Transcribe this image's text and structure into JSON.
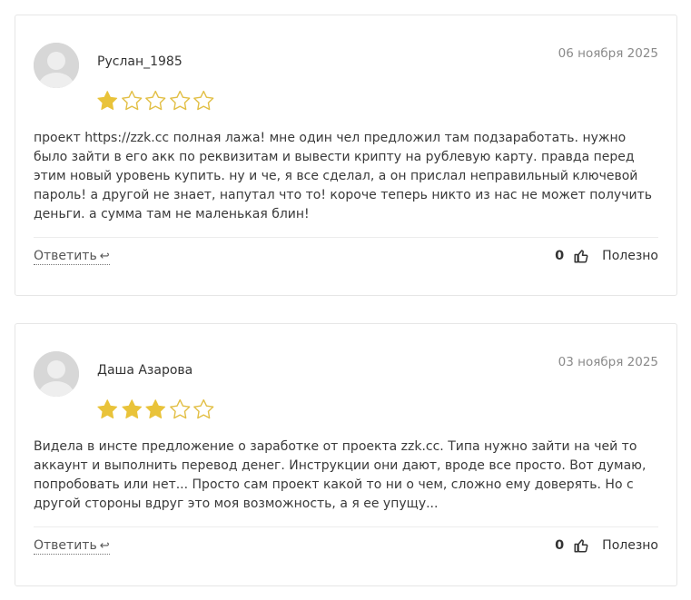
{
  "theme": {
    "star_filled": "#e9c33a",
    "star_empty_stroke": "#e2bf45",
    "avatar_bg": "#d7d7d7",
    "border": "#e6e6e6"
  },
  "reviews": [
    {
      "author": "Руслан_1985",
      "date": "06 ноября 2025",
      "rating": 1,
      "max_rating": 5,
      "text": "проект https://zzk.cc полная лажа! мне один чел предложил там подзаработать. нужно было зайти в его акк по реквизитам и вывести крипту на рублевую карту. правда перед этим новый уровень купить. ну и че, я все сделал, а он прислал неправильный ключевой пароль! а другой не знает, напутал что то! короче теперь никто из нас не может получить деньги. а сумма там не маленькая блин!",
      "reply_label": "Ответить",
      "reply_icon": "reply-arrow-icon",
      "helpful_count": "0",
      "helpful_icon": "thumbs-up-icon",
      "helpful_label": "Полезно"
    },
    {
      "author": "Даша Азарова",
      "date": "03 ноября 2025",
      "rating": 3,
      "max_rating": 5,
      "text": "Видела в инсте предложение о заработке от проекта zzk.cc. Типа нужно зайти на чей то аккаунт и выполнить перевод денег. Инструкции они дают, вроде все просто. Вот думаю, попробовать или нет... Просто сам проект какой то ни о чем, сложно ему доверять. Но с другой стороны вдруг это моя возможность, а я ее упущу...",
      "reply_label": "Ответить",
      "reply_icon": "reply-arrow-icon",
      "helpful_count": "0",
      "helpful_icon": "thumbs-up-icon",
      "helpful_label": "Полезно"
    }
  ]
}
